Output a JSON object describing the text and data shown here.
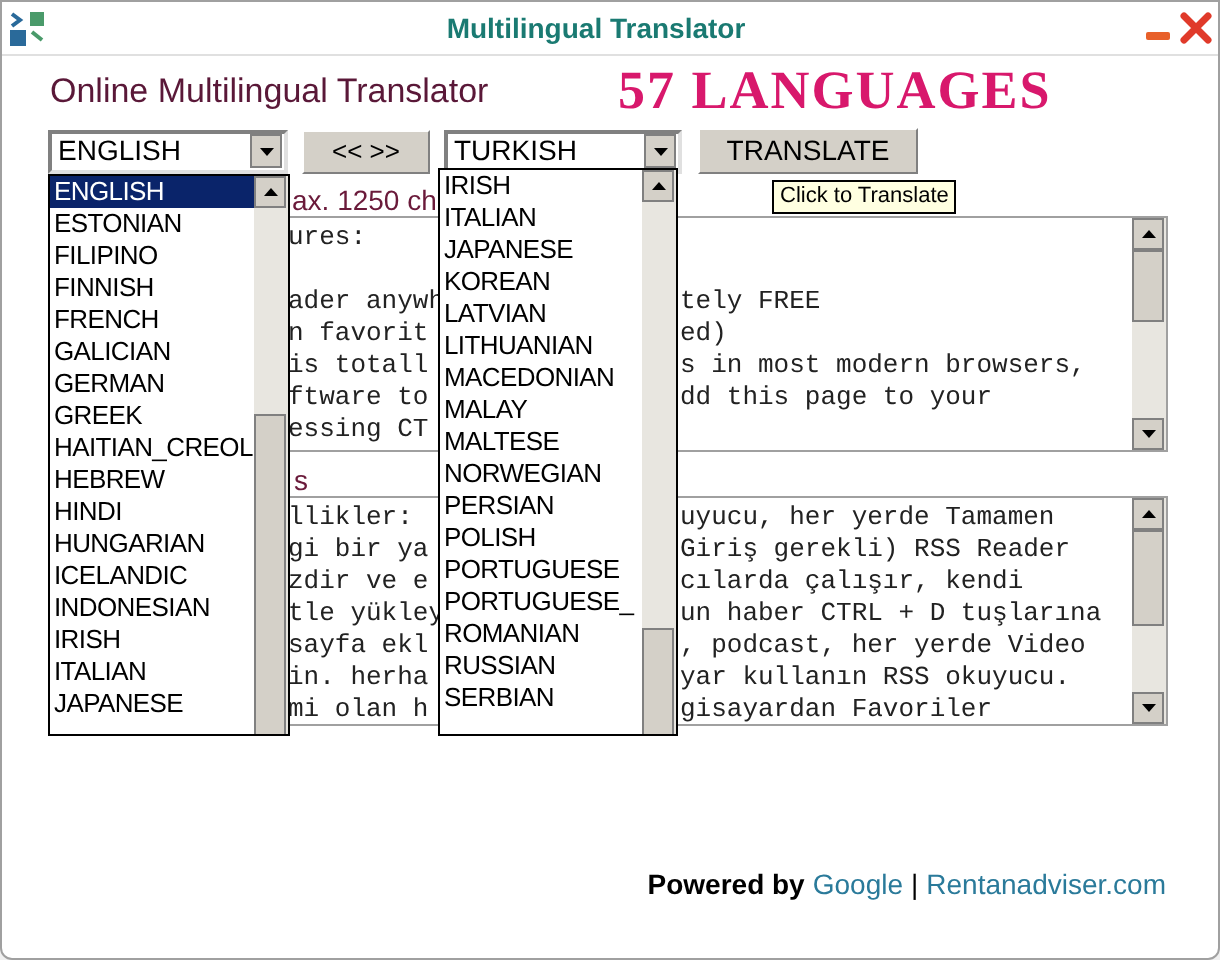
{
  "window": {
    "title": "Multilingual Translator"
  },
  "header": {
    "title": "Online Multilingual Translator",
    "badge": "57 LANGUAGES"
  },
  "source_select": {
    "value": "ENGLISH"
  },
  "swap_button": {
    "label": "<< >>"
  },
  "target_select": {
    "value": "TURKISH"
  },
  "translate_button": {
    "label": "TRANSLATE"
  },
  "tooltip": {
    "text": "Click to Translate"
  },
  "source_list": {
    "items": [
      {
        "label": "ENGLISH",
        "selected": true
      },
      {
        "label": "ESTONIAN",
        "selected": false
      },
      {
        "label": "FILIPINO",
        "selected": false
      },
      {
        "label": "FINNISH",
        "selected": false
      },
      {
        "label": "FRENCH",
        "selected": false
      },
      {
        "label": "GALICIAN",
        "selected": false
      },
      {
        "label": "GERMAN",
        "selected": false
      },
      {
        "label": "GREEK",
        "selected": false
      },
      {
        "label": "HAITIAN_CREOL",
        "selected": false
      },
      {
        "label": "HEBREW",
        "selected": false
      },
      {
        "label": "HINDI",
        "selected": false
      },
      {
        "label": "HUNGARIAN",
        "selected": false
      },
      {
        "label": "ICELANDIC",
        "selected": false
      },
      {
        "label": "INDONESIAN",
        "selected": false
      },
      {
        "label": "IRISH",
        "selected": false
      },
      {
        "label": "ITALIAN",
        "selected": false
      },
      {
        "label": "JAPANESE",
        "selected": false
      }
    ]
  },
  "target_list": {
    "items": [
      {
        "label": "IRISH",
        "selected": false
      },
      {
        "label": "ITALIAN",
        "selected": false
      },
      {
        "label": "JAPANESE",
        "selected": false
      },
      {
        "label": "KOREAN",
        "selected": false
      },
      {
        "label": "LATVIAN",
        "selected": false
      },
      {
        "label": "LITHUANIAN",
        "selected": false
      },
      {
        "label": "MACEDONIAN",
        "selected": false
      },
      {
        "label": "MALAY",
        "selected": false
      },
      {
        "label": "MALTESE",
        "selected": false
      },
      {
        "label": "NORWEGIAN",
        "selected": false
      },
      {
        "label": "PERSIAN",
        "selected": false
      },
      {
        "label": "POLISH",
        "selected": false
      },
      {
        "label": "PORTUGUESE",
        "selected": false
      },
      {
        "label": "PORTUGUESE_",
        "selected": false
      },
      {
        "label": "ROMANIAN",
        "selected": false
      },
      {
        "label": "RUSSIAN",
        "selected": false
      },
      {
        "label": "SERBIAN",
        "selected": false
      }
    ]
  },
  "input_label": "ax. 1250 ch",
  "input_text": {
    "lines": [
      {
        "left": "ures:"
      },
      {
        "left": "ader anywh",
        "right": "tely FREE",
        "space_before": true
      },
      {
        "left": "n favorit",
        "right": "ed)"
      },
      {
        "left": "is totall",
        "right": "s in most modern browsers,"
      },
      {
        "left": "ftware to",
        "right": "dd this page to your"
      },
      {
        "left": "essing CT"
      }
    ]
  },
  "output_label": "s",
  "output_text": {
    "lines": [
      {
        "left": "llikler:",
        "right": "uyucu, her yerde Tamamen"
      },
      {
        "left": "gi bir ya",
        "right": "Giriş gerekli) RSS Reader"
      },
      {
        "left": "zdir ve e",
        "right": "cılarda çalışır, kendi"
      },
      {
        "left": "tle yükley",
        "right": "un haber CTRL + D tuşlarına"
      },
      {
        "left": "sayfa ekl",
        "right": ", podcast, her yerde Video"
      },
      {
        "left": "in. herha",
        "right": "yar kullanın RSS okuyucu."
      },
      {
        "left": "mi olan h",
        "right": "gisayardan Favoriler"
      }
    ]
  },
  "footer": {
    "prefix": "Powered by",
    "links": [
      "Google",
      "Rentanadviser.com"
    ],
    "separator": "|"
  }
}
